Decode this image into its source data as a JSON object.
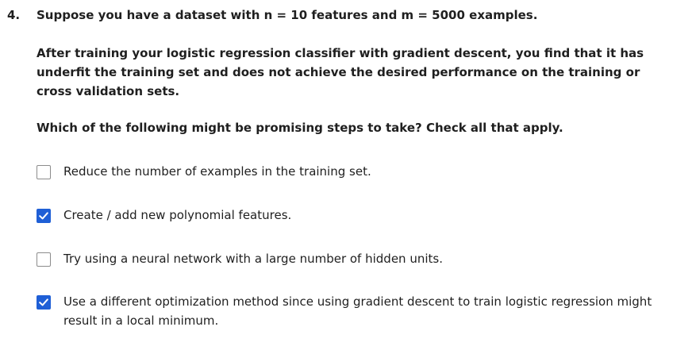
{
  "question": {
    "number": "4.",
    "title": "Suppose you have a dataset with n = 10 features and m = 5000 examples.",
    "paragraph": "After training your logistic regression classifier with gradient descent, you find that it has underfit the training set and does not achieve the desired performance on the training or cross validation sets.",
    "prompt": "Which of the following might be promising steps to take? Check all that apply."
  },
  "options": [
    {
      "label": "Reduce the number of examples in the training set.",
      "checked": false
    },
    {
      "label": "Create / add new polynomial features.",
      "checked": true
    },
    {
      "label": "Try using a neural network with a large number of hidden units.",
      "checked": false
    },
    {
      "label": "Use a different optimization method since using gradient descent to train logistic regression might result in a local minimum.",
      "checked": true
    }
  ],
  "colors": {
    "checked_fill": "#1f5fd6",
    "unchecked_border": "#8c8c8c",
    "text": "#1f1f1f"
  }
}
